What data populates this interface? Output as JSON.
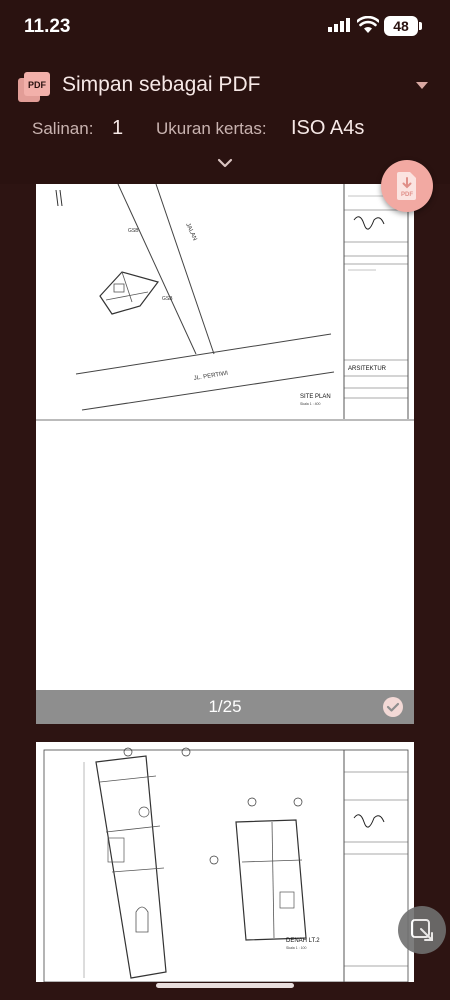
{
  "status_bar": {
    "time": "11.23",
    "battery": "48"
  },
  "header": {
    "destination": "Simpan sebagai PDF",
    "copies_label": "Salinan:",
    "copies_value": "1",
    "paper_label": "Ukuran kertas:",
    "paper_value": "ISO A4s"
  },
  "preview": {
    "page_indicator": "1/25",
    "page1_labels": {
      "road_1": "JALAN",
      "road_2": "JL. PERTIWI",
      "gsb_1": "GSB",
      "gsb_2": "GSB",
      "plan_title": "SITE PLAN",
      "plan_scale": "Skala 1 : 400",
      "dept": "ARSITEKTUR"
    },
    "page2_labels": {
      "plan_title": "DENAH LT.2",
      "plan_scale": "Skala 1 : 100"
    }
  },
  "icons": {
    "pdf": "pdf-file-icon",
    "caret": "dropdown-caret-icon",
    "chevron": "chevron-down-icon",
    "fab": "save-pdf-icon",
    "check": "check-circle-icon",
    "overlay": "screen-overlay-icon"
  },
  "colors": {
    "background": "#2d1412",
    "header": "#2a1210",
    "accent": "#f2a9a2",
    "page_footer": "#8e8e8e"
  }
}
